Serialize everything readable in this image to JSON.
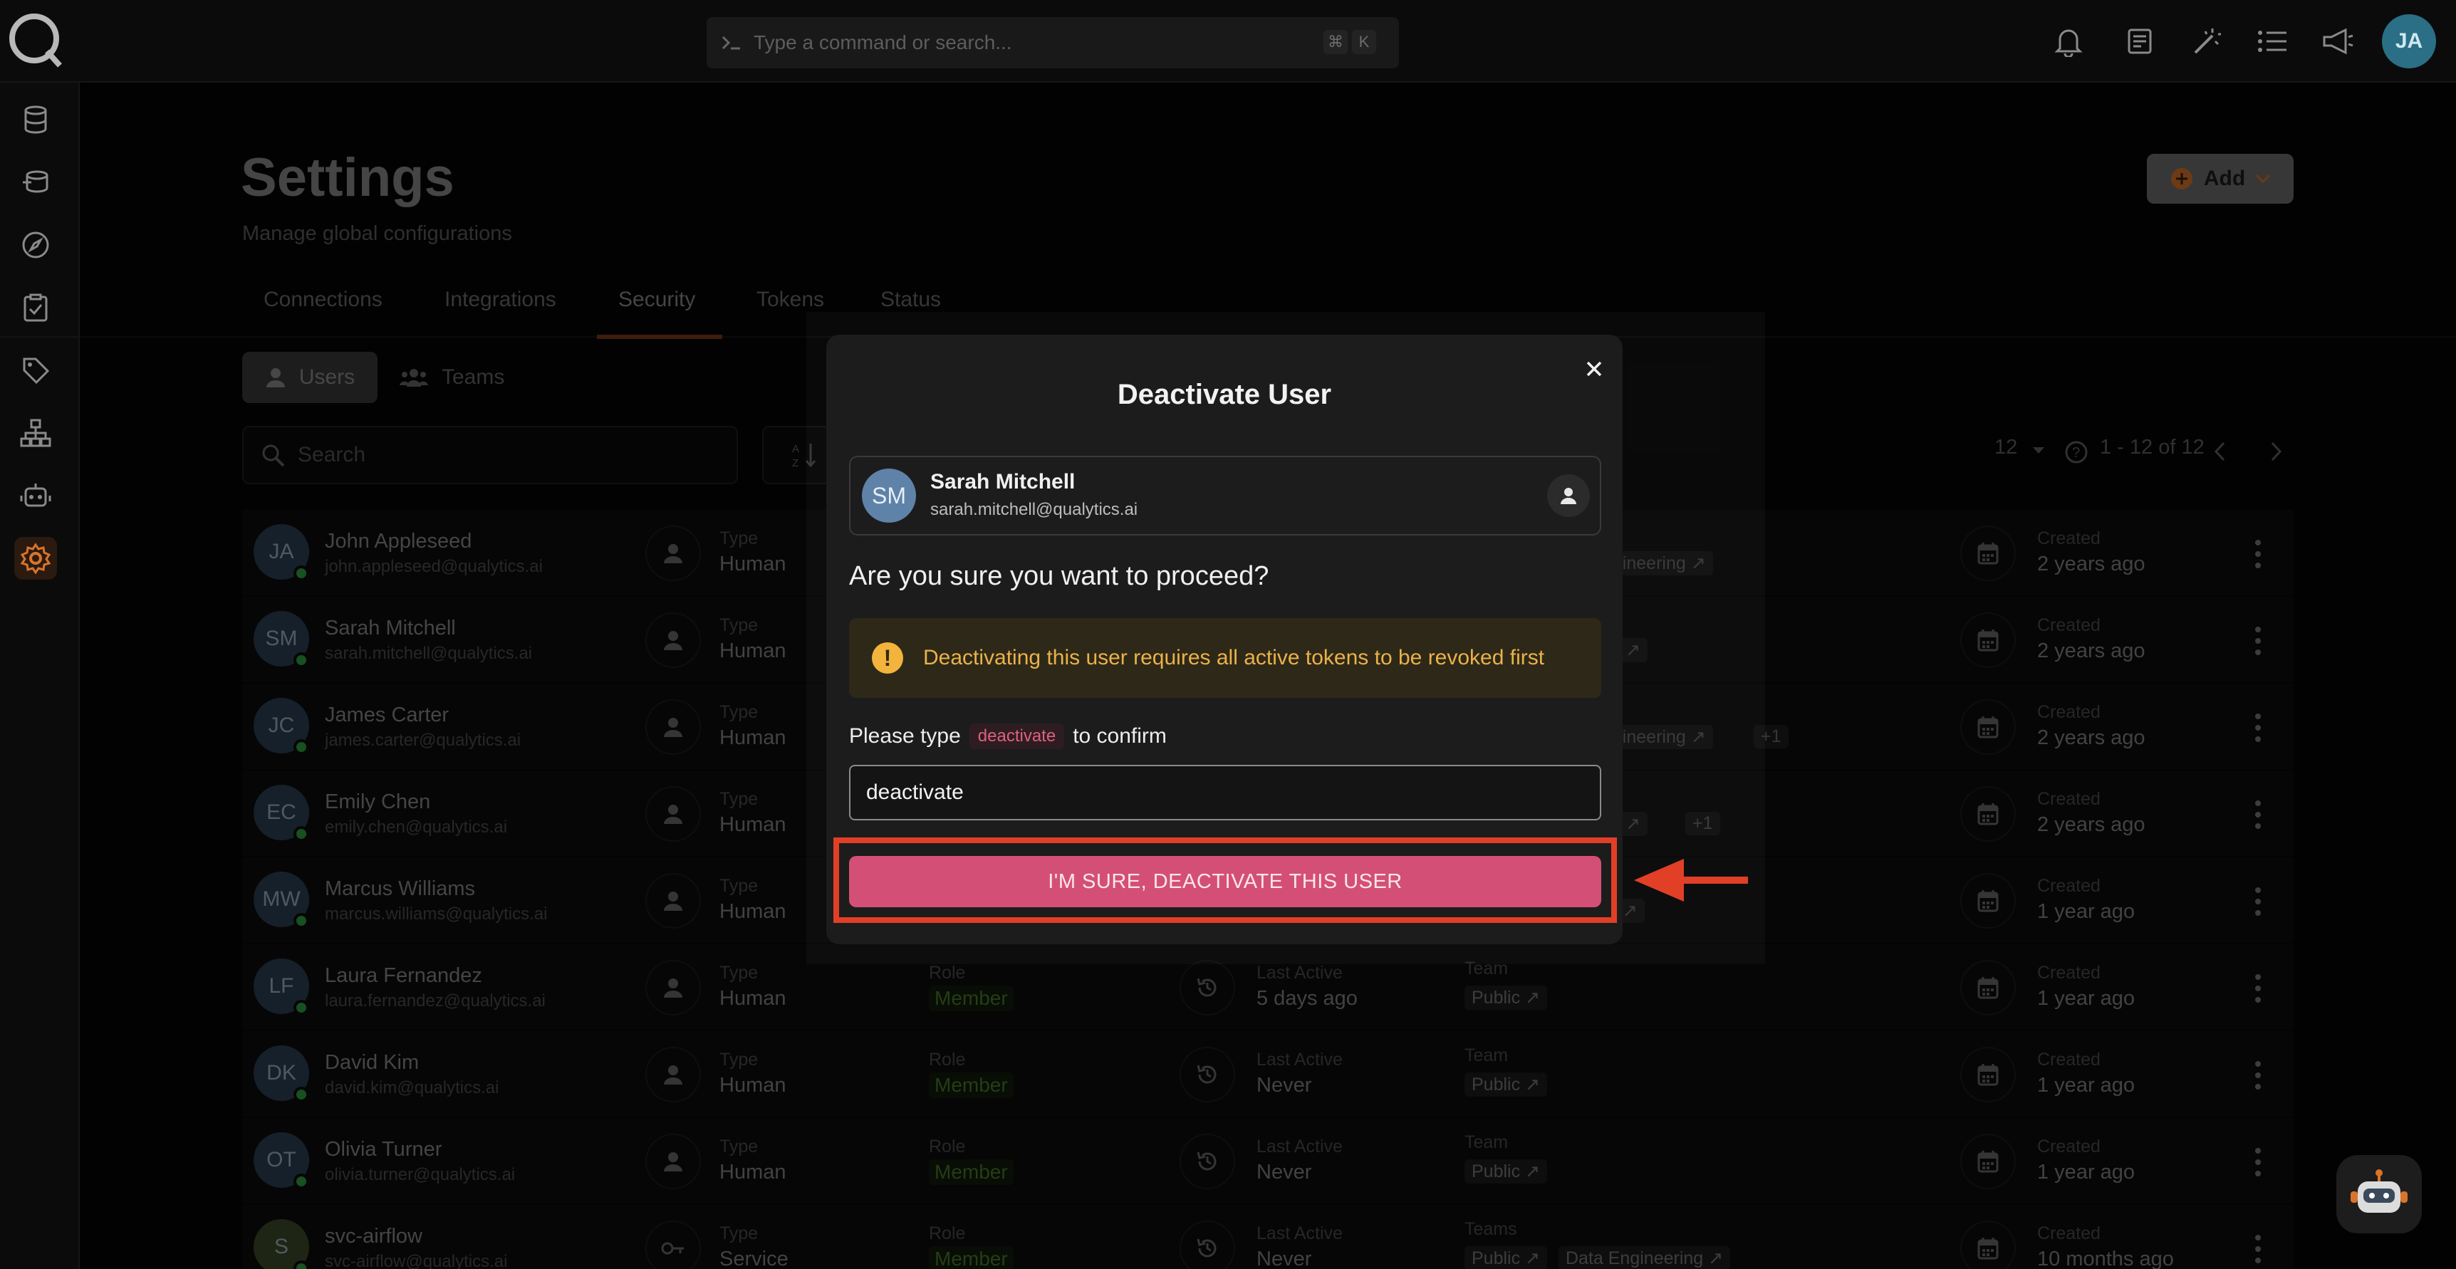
{
  "topbar": {
    "search_placeholder": "Type a command or search...",
    "shortcut_keys": [
      "⌘",
      "K"
    ],
    "avatar_initials": "JA",
    "icons": [
      "bell-icon",
      "document-icon",
      "wand-icon",
      "list-icon",
      "megaphone-icon"
    ]
  },
  "sidebar": {
    "items": [
      "database-icon",
      "stack-icon",
      "compass-icon",
      "checklist-icon",
      "tag-icon",
      "hierarchy-icon",
      "robot-icon",
      "gear-icon"
    ],
    "active": "gear-icon"
  },
  "page": {
    "title": "Settings",
    "subtitle": "Manage global configurations",
    "add_label": "Add"
  },
  "tabs": [
    "Connections",
    "Integrations",
    "Security",
    "Tokens",
    "Status"
  ],
  "active_tab": "Security",
  "segments": {
    "users": "Users",
    "teams": "Teams"
  },
  "search": {
    "placeholder": "Search"
  },
  "pagination": {
    "per_page": "12",
    "range": "1 - 12 of 12"
  },
  "labels": {
    "type": "Type",
    "role": "Role",
    "last_active": "Last Active",
    "team": "Team",
    "teams": "Teams",
    "created": "Created"
  },
  "users": [
    {
      "initials": "JA",
      "name": "John Appleseed",
      "email": "john.appleseed@qualytics.ai",
      "type": "Human",
      "created": "2 years ago",
      "chips": [
        "ngineering ↗"
      ]
    },
    {
      "initials": "SM",
      "name": "Sarah Mitchell",
      "email": "sarah.mitchell@qualytics.ai",
      "type": "Human",
      "created": "2 years ago",
      "chips": [
        "cs ↗"
      ]
    },
    {
      "initials": "JC",
      "name": "James Carter",
      "email": "james.carter@qualytics.ai",
      "type": "Human",
      "created": "2 years ago",
      "chips": [
        "ngineering ↗",
        "+1"
      ]
    },
    {
      "initials": "EC",
      "name": "Emily Chen",
      "email": "emily.chen@qualytics.ai",
      "type": "Human",
      "created": "2 years ago",
      "chips": [
        "cs ↗",
        "+1"
      ]
    },
    {
      "initials": "MW",
      "name": "Marcus Williams",
      "email": "marcus.williams@qualytics.ai",
      "type": "Human",
      "created": "1 year ago",
      "chips": [
        "m ↗"
      ]
    },
    {
      "initials": "LF",
      "name": "Laura Fernandez",
      "email": "laura.fernandez@qualytics.ai",
      "type": "Human",
      "role": "Member",
      "last_active": "5 days ago",
      "team": "Public ↗",
      "created": "1 year ago"
    },
    {
      "initials": "DK",
      "name": "David Kim",
      "email": "david.kim@qualytics.ai",
      "type": "Human",
      "role": "Member",
      "last_active": "Never",
      "team": "Public ↗",
      "created": "1 year ago"
    },
    {
      "initials": "OT",
      "name": "Olivia Turner",
      "email": "olivia.turner@qualytics.ai",
      "type": "Human",
      "role": "Member",
      "last_active": "Never",
      "team": "Public ↗",
      "created": "1 year ago"
    },
    {
      "initials": "S",
      "name": "svc-airflow",
      "email": "svc-airflow@qualytics.ai",
      "type": "Service",
      "role": "Member",
      "last_active": "Never",
      "team": "Public ↗",
      "team2": "Data Engineering ↗",
      "created": "10 months ago"
    }
  ],
  "modal": {
    "title": "Deactivate User",
    "user_initials": "SM",
    "user_name": "Sarah Mitchell",
    "user_email": "sarah.mitchell@qualytics.ai",
    "question": "Are you sure you want to proceed?",
    "warning": "Deactivating this user requires all active tokens to be revoked first",
    "confirm_prefix": "Please type",
    "confirm_code": "deactivate",
    "confirm_suffix": "to confirm",
    "input_value": "deactivate",
    "button_label": "I'M SURE, DEACTIVATE THIS USER"
  },
  "colors": {
    "accent": "#d44f76",
    "highlight": "#e23f27",
    "warning": "#e9b24a",
    "brand_orange": "#d9742a"
  }
}
